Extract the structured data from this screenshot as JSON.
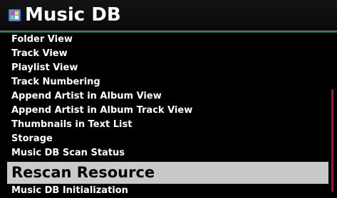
{
  "header": {
    "title": "Music DB",
    "icon": "music-db-icon"
  },
  "menu": {
    "items": [
      {
        "label": "Folder View",
        "selected": false
      },
      {
        "label": "Track View",
        "selected": false
      },
      {
        "label": "Playlist View",
        "selected": false
      },
      {
        "label": "Track Numbering",
        "selected": false
      },
      {
        "label": "Append Artist in Album View",
        "selected": false
      },
      {
        "label": "Append Artist in Album Track View",
        "selected": false
      },
      {
        "label": "Thumbnails in Text List",
        "selected": false
      },
      {
        "label": "Storage",
        "selected": false
      },
      {
        "label": "Music DB Scan Status",
        "selected": false
      },
      {
        "label": "Rescan Resource",
        "selected": true
      },
      {
        "label": "Music DB Initialization",
        "selected": false
      }
    ]
  },
  "colors": {
    "background": "#000000",
    "header_rule": "#2f9a60",
    "selection": "#c9c9c9",
    "scrollbar": "#b3083a"
  }
}
